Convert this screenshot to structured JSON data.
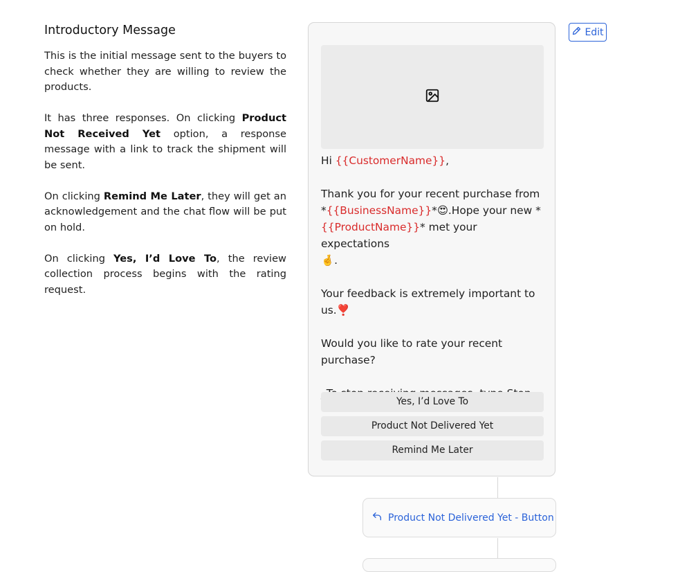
{
  "section": {
    "title": "Introductory Message",
    "para1": "This is the initial message sent to the buyers to check whether they are willing to review the products.",
    "para2_pre": "It has three responses. On clicking ",
    "para2_bold": "Product Not Received Yet",
    "para2_post": " option, a response message with a link to track the shipment will be sent.",
    "para3_pre": "On clicking ",
    "para3_bold": "Remind Me Later",
    "para3_post": ", they will get an acknowledgement and the chat flow will be put on hold.",
    "para4_pre": "On clicking ",
    "para4_bold": "Yes, I’d Love To",
    "para4_post": ", the review collection process begins with the rating request."
  },
  "edit_button": {
    "label": "Edit",
    "icon": "pencil-icon"
  },
  "message": {
    "media_icon": "image-icon",
    "greeting_pre": "Hi ",
    "customer_var": "{{CustomerName}}",
    "greeting_post": ",",
    "thanks_pre": "Thank you for your recent purchase from\n*",
    "business_var": "{{BusinessName}}",
    "thanks_mid": "*😍.Hope your new *\n",
    "product_var": "{{ProductName}}",
    "thanks_post": "* met your expectations\n🤞.",
    "feedback": "Your feedback is extremely important to\nus.❣️",
    "question": "Would you like to rate your recent\npurchase?",
    "footer": "_To stop receiving messages, type Stop_"
  },
  "quick_replies": [
    "Yes, I’d Love To",
    "Product Not Delivered Yet",
    "Remind Me Later"
  ],
  "branch": {
    "label": "Product Not Delivered Yet - Button",
    "icon": "reply-icon"
  },
  "colors": {
    "accent": "#2b63d9",
    "variable": "#d92b2b"
  }
}
